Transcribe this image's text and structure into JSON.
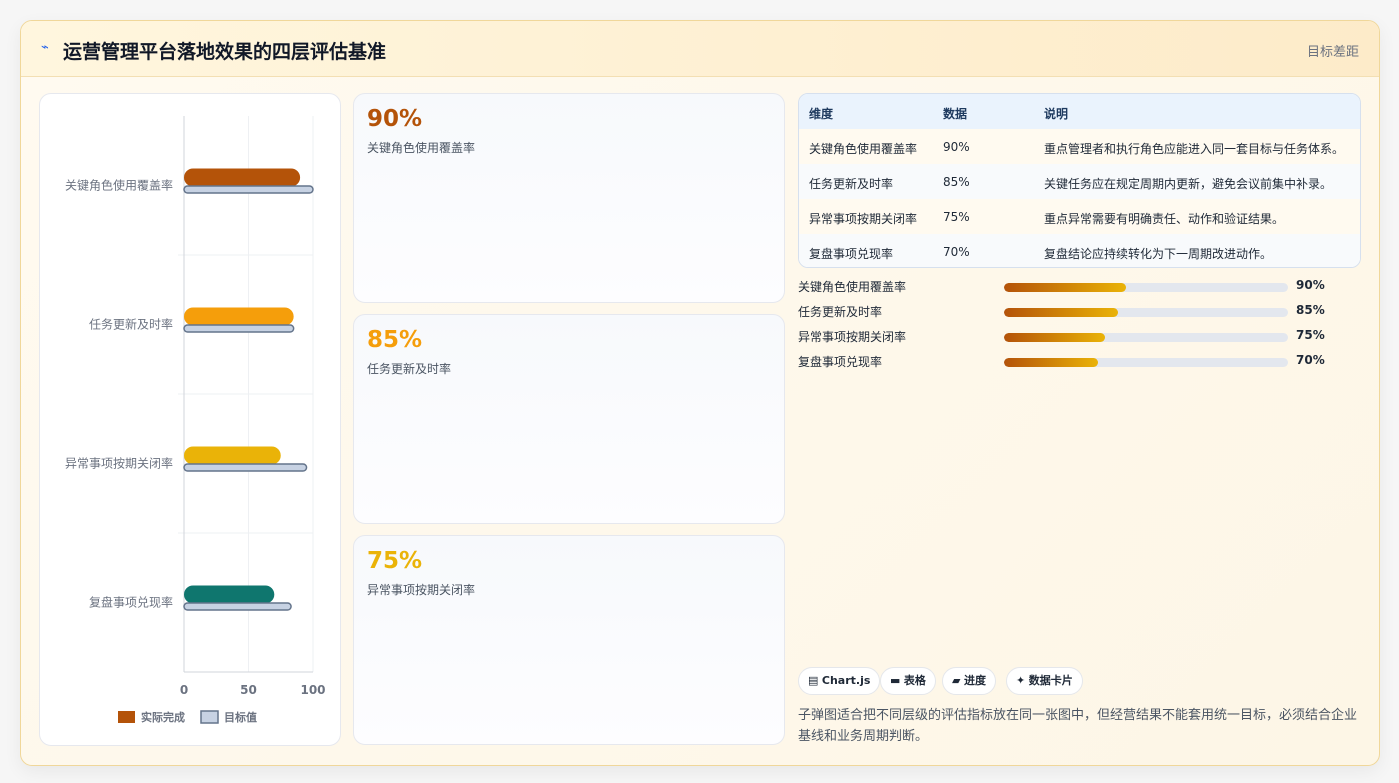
{
  "header": {
    "icon": "bolt-icon",
    "title": "运营管理平台落地效果的四层评估基准",
    "right_label": "目标差距"
  },
  "chart_data": {
    "type": "bar",
    "orientation": "horizontal",
    "categories": [
      "关键角色使用覆盖率",
      "任务更新及时率",
      "异常事项按期关闭率",
      "复盘事项兑现率"
    ],
    "series": [
      {
        "name": "实际完成",
        "values": [
          90,
          85,
          75,
          70
        ],
        "colors": [
          "#b45309",
          "#f59e0b",
          "#eab308",
          "#0f766e"
        ]
      },
      {
        "name": "目标值",
        "values": [
          100,
          85,
          95,
          83
        ],
        "color": "#c7d2e3"
      }
    ],
    "xticks": [
      "0",
      "50",
      "100"
    ],
    "xlim": [
      0,
      100
    ],
    "grid": true,
    "legend_position": "bottom"
  },
  "stats": [
    {
      "value": "90%",
      "label": "关键角色使用覆盖率",
      "color": "#b45309"
    },
    {
      "value": "85%",
      "label": "任务更新及时率",
      "color": "#f59e0b"
    },
    {
      "value": "75%",
      "label": "异常事项按期关闭率",
      "color": "#eab308"
    }
  ],
  "table": {
    "headers": [
      "维度",
      "数据",
      "说明"
    ],
    "rows": [
      [
        "关键角色使用覆盖率",
        "90%",
        "重点管理者和执行角色应能进入同一套目标与任务体系。"
      ],
      [
        "任务更新及时率",
        "85%",
        "关键任务应在规定周期内更新，避免会议前集中补录。"
      ],
      [
        "异常事项按期关闭率",
        "75%",
        "重点异常需要有明确责任、动作和验证结果。"
      ],
      [
        "复盘事项兑现率",
        "70%",
        "复盘结论应持续转化为下一周期改进动作。"
      ]
    ]
  },
  "progress": [
    {
      "label": "关键角色使用覆盖率",
      "value": "90%",
      "fill": 0.43
    },
    {
      "label": "任务更新及时率",
      "value": "85%",
      "fill": 0.4
    },
    {
      "label": "异常事项按期关闭率",
      "value": "75%",
      "fill": 0.355
    },
    {
      "label": "复盘事项兑现率",
      "value": "70%",
      "fill": 0.33
    }
  ],
  "chips": [
    {
      "icon": "chart-icon",
      "glyph": "▤",
      "label": "Chart.js"
    },
    {
      "icon": "table-icon",
      "glyph": "▬",
      "label": "表格"
    },
    {
      "icon": "progress-icon",
      "glyph": "▰",
      "label": "进度"
    },
    {
      "icon": "sparkle-icon",
      "glyph": "✦",
      "label": "数据卡片"
    }
  ],
  "note": "子弹图适合把不同层级的评估指标放在同一张图中，但经营结果不能套用统一目标，必须结合企业基线和业务周期判断。"
}
